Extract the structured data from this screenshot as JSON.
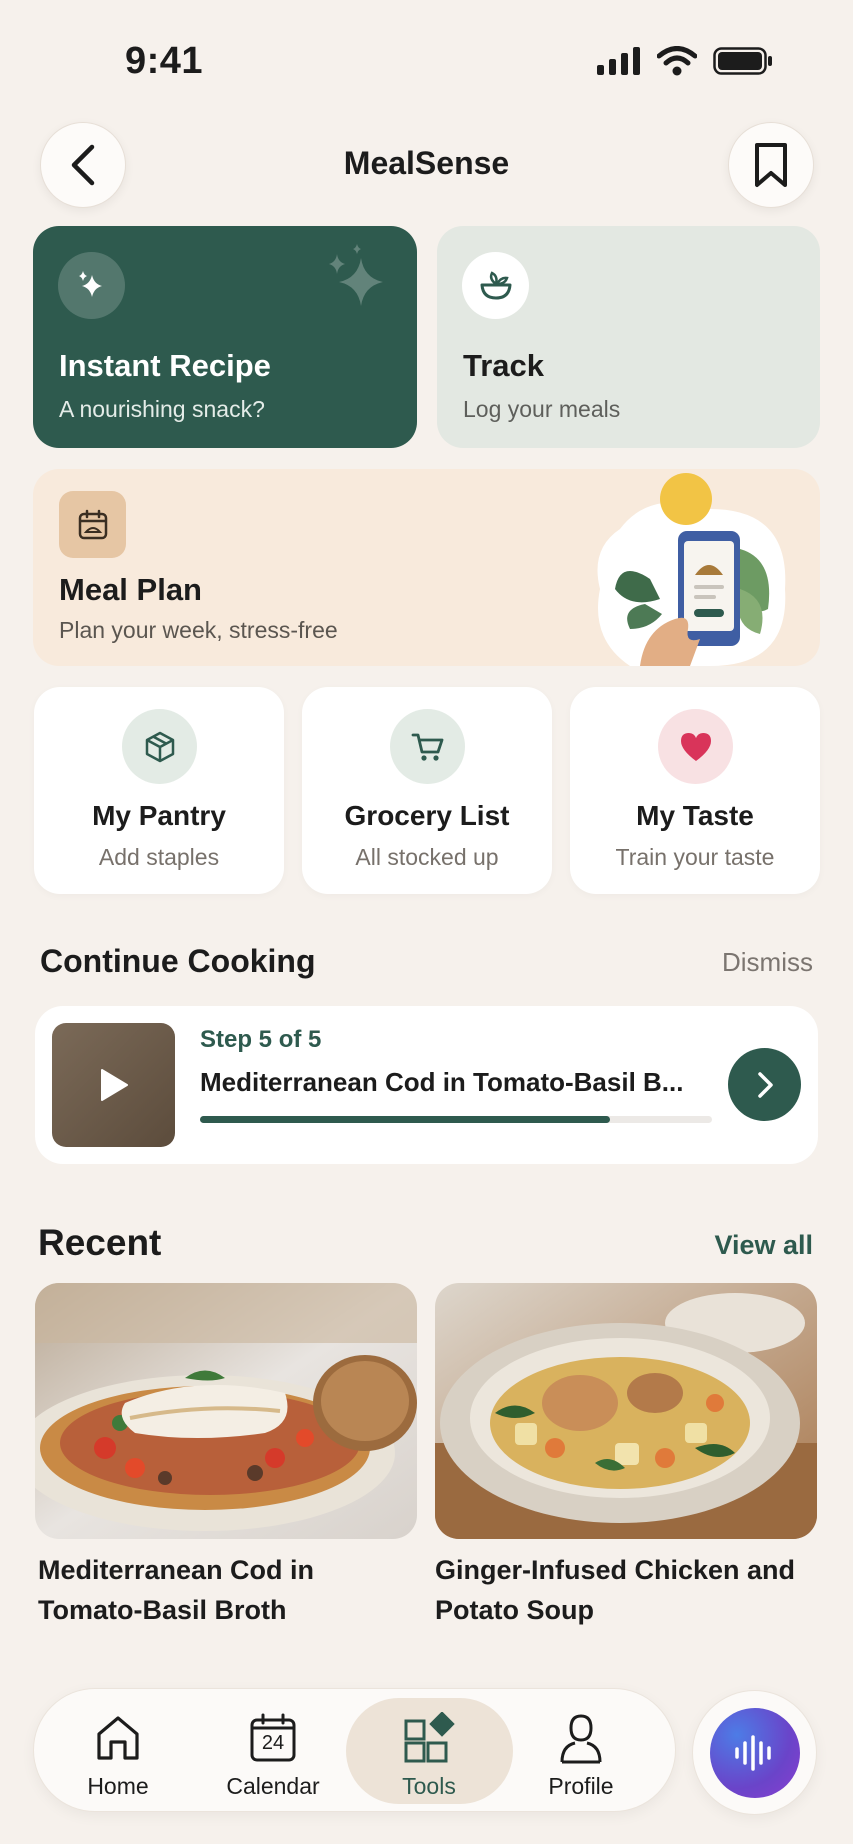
{
  "status_bar": {
    "time": "9:41"
  },
  "header": {
    "title": "MealSense"
  },
  "cards": {
    "instant": {
      "title": "Instant Recipe",
      "subtitle": "A nourishing snack?"
    },
    "track": {
      "title": "Track",
      "subtitle": "Log your meals"
    },
    "meal_plan": {
      "title": "Meal Plan",
      "subtitle": "Plan your week, stress-free"
    }
  },
  "small_cards": [
    {
      "title": "My Pantry",
      "subtitle": "Add staples"
    },
    {
      "title": "Grocery List",
      "subtitle": "All stocked up"
    },
    {
      "title": "My Taste",
      "subtitle": "Train your taste"
    }
  ],
  "continue_cooking": {
    "title": "Continue Cooking",
    "dismiss": "Dismiss",
    "step": "Step 5 of 5",
    "recipe": "Mediterranean Cod in Tomato-Basil B...",
    "progress": 0.8
  },
  "recent": {
    "title": "Recent",
    "view_all": "View all",
    "items": [
      {
        "name": "Mediterranean Cod in Tomato-Basil Broth"
      },
      {
        "name": "Ginger-Infused Chicken and Potato Soup"
      }
    ]
  },
  "tabbar": {
    "tabs": [
      {
        "label": "Home",
        "icon": "home-icon"
      },
      {
        "label": "Calendar",
        "icon": "calendar-icon",
        "badge": "24"
      },
      {
        "label": "Tools",
        "icon": "tools-icon",
        "active": true
      },
      {
        "label": "Profile",
        "icon": "profile-icon"
      }
    ]
  },
  "colors": {
    "primary": "#2e5a4e",
    "background": "#f6f1ec",
    "heart": "#d9345a"
  }
}
